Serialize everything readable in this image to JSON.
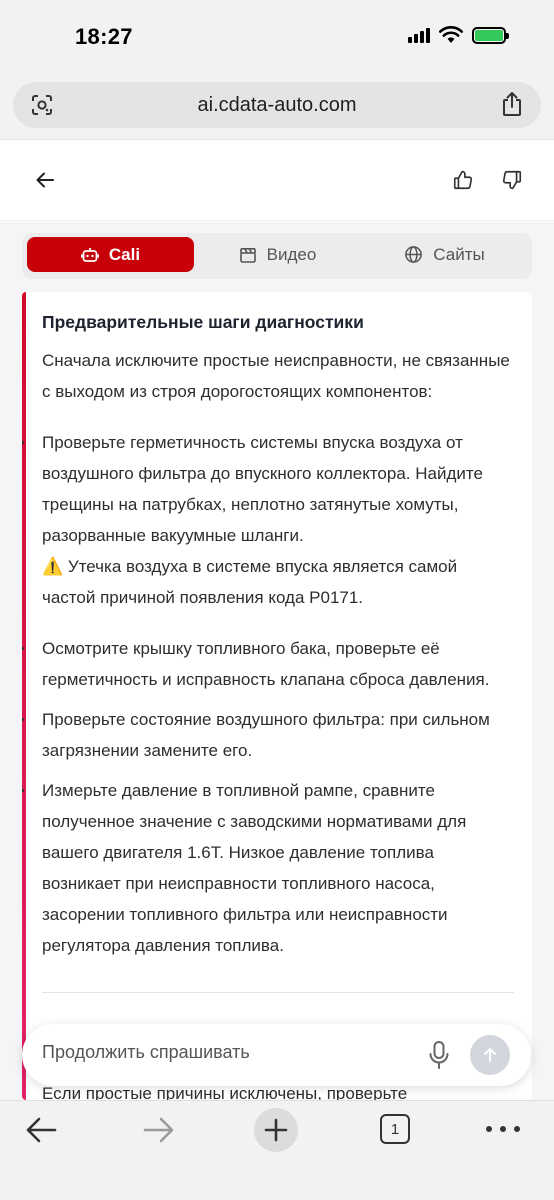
{
  "status_bar": {
    "time": "18:27"
  },
  "browser": {
    "url": "ai.cdata-auto.com"
  },
  "tabs": [
    {
      "label": "Cali",
      "icon": "robot-icon",
      "active": true
    },
    {
      "label": "Видео",
      "icon": "clapperboard-icon",
      "active": false
    },
    {
      "label": "Сайты",
      "icon": "globe-icon",
      "active": false
    }
  ],
  "answer": {
    "heading": "Предварительные шаги диагностики",
    "intro": "Сначала исключите простые неисправности, не связанные с выходом из строя дорогостоящих компонентов:",
    "items": [
      {
        "text": "Проверьте герметичность системы впуска воздуха от воздушного фильтра до впускного коллектора. Найдите трещины на патрубках, неплотно затянутые хомуты, разорванные вакуумные шланги.",
        "warning": "⚠️ Утечка воздуха в системе впуска является самой частой причиной появления кода P0171."
      },
      {
        "text": "Осмотрите крышку топливного бака, проверьте её герметичность и исправность клапана сброса давления."
      },
      {
        "text": "Проверьте состояние воздушного фильтра: при сильном загрязнении замените его."
      },
      {
        "text": "Измерьте давление в топливной рампе, сравните полученное значение с заводскими нормативами для вашего двигателя 1.6T. Низкое давление топлива возникает при неисправности топливного насоса, засорении топливного фильтра или неисправности регулятора давления топлива."
      }
    ],
    "partial_next": "Если простые причины исключены, проверьте"
  },
  "ask": {
    "placeholder": "Продолжить спрашивать"
  },
  "toolbar": {
    "tab_count": "1"
  },
  "colors": {
    "accent": "#c8000a",
    "accent_bar": "#d20a2a"
  }
}
